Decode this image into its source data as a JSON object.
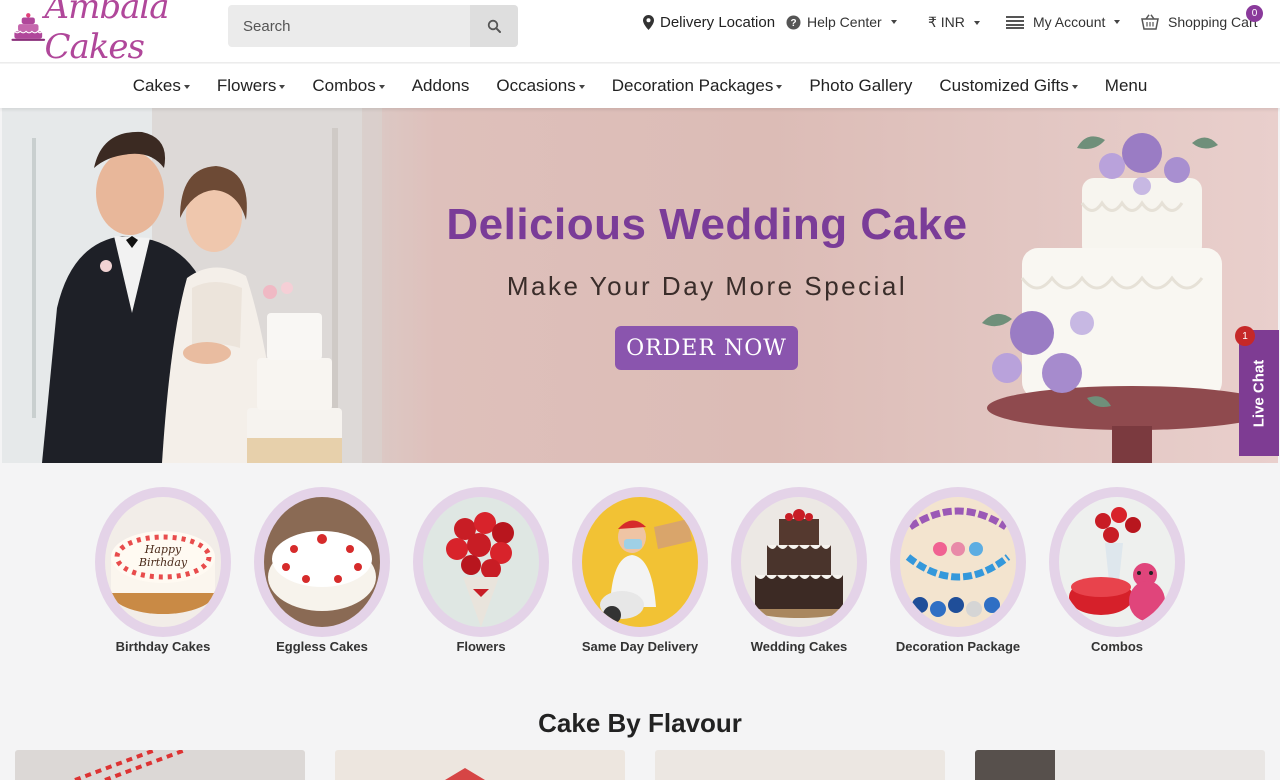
{
  "brand": {
    "name": "Ambala Cakes",
    "color": "#b0479a"
  },
  "search": {
    "placeholder": "Search"
  },
  "header": {
    "delivery_location": "Delivery Location",
    "help_center": "Help Center",
    "currency": "₹ INR",
    "my_account": "My Account",
    "shopping_cart": "Shopping Cart",
    "cart_count": "0"
  },
  "nav": [
    {
      "label": "Cakes",
      "dropdown": true
    },
    {
      "label": "Flowers",
      "dropdown": true
    },
    {
      "label": "Combos",
      "dropdown": true
    },
    {
      "label": "Addons",
      "dropdown": false
    },
    {
      "label": "Occasions",
      "dropdown": true
    },
    {
      "label": "Decoration Packages",
      "dropdown": true
    },
    {
      "label": "Photo Gallery",
      "dropdown": false
    },
    {
      "label": "Customized Gifts",
      "dropdown": true
    },
    {
      "label": "Menu",
      "dropdown": false
    }
  ],
  "banner": {
    "title": "Delicious Wedding Cake",
    "subtitle": "Make Your Day More Special",
    "cta": "ORDER NOW"
  },
  "live_chat": {
    "label": "Live Chat",
    "badge": "1"
  },
  "categories": [
    {
      "label": "Birthday Cakes"
    },
    {
      "label": "Eggless Cakes"
    },
    {
      "label": "Flowers"
    },
    {
      "label": "Same Day Delivery"
    },
    {
      "label": "Wedding Cakes"
    },
    {
      "label": "Decoration Package"
    },
    {
      "label": "Combos"
    }
  ],
  "sections": {
    "cake_by_flavour": "Cake By Flavour"
  },
  "colors": {
    "accent": "#7e3c93",
    "banner_title": "#7a3c98",
    "button": "#8a55ae"
  }
}
